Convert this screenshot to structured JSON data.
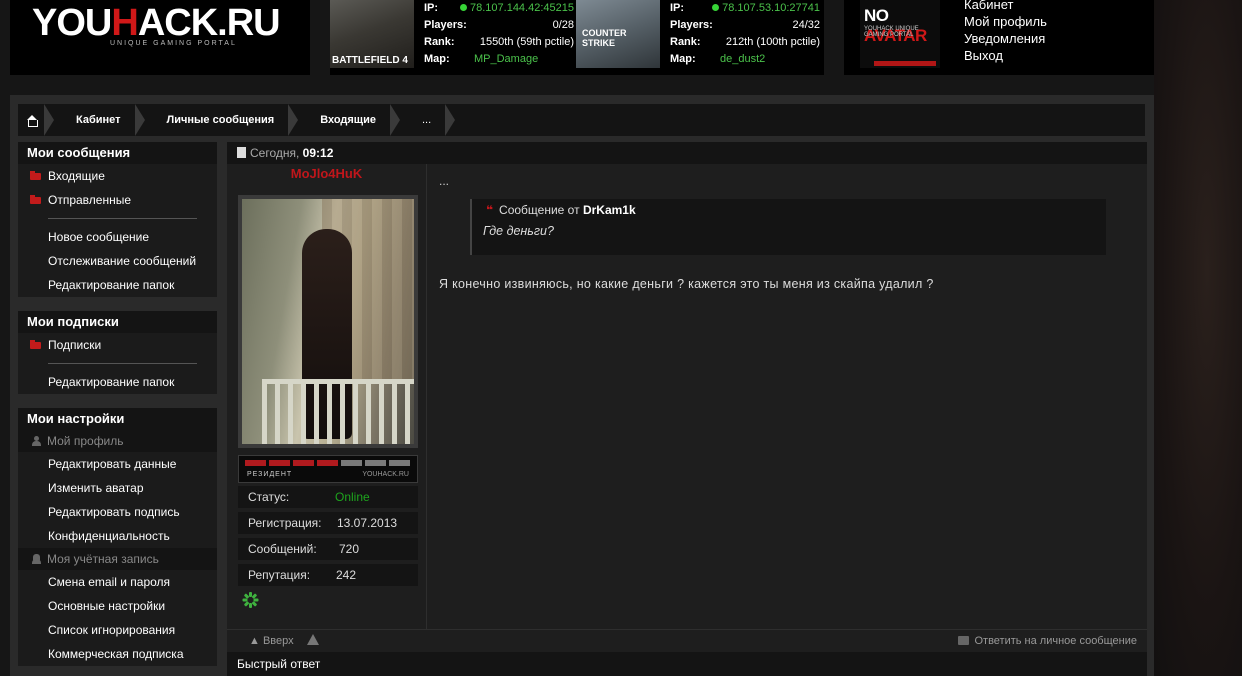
{
  "header": {
    "logo_main_left": "YOU",
    "logo_main_red": "H",
    "logo_main_right": "ACK.RU",
    "logo_sub": "UNIQUE GAMING PORTAL"
  },
  "servers": [
    {
      "game": "BATTLEFIELD 4",
      "ip_label": "IP:",
      "ip": "78.107.144.42:45215",
      "players_label": "Players:",
      "players": "0/28",
      "rank_label": "Rank:",
      "rank": "1550th (59th pctile)",
      "map_label": "Map:",
      "map": "MP_Damage"
    },
    {
      "game": "COUNTER STRIKE",
      "ip_label": "IP:",
      "ip": "78.107.53.10:27741",
      "players_label": "Players:",
      "players": "24/32",
      "rank_label": "Rank:",
      "rank": "212th (100th pctile)",
      "map_label": "Map:",
      "map": "de_dust2"
    }
  ],
  "user_menu": {
    "avatar_big_left": "NO ",
    "avatar_big_red": "AVATAR",
    "avatar_small": "YOUHACK UNIQUE GAMING PORTAL",
    "items": [
      "Кабинет",
      "Мой профиль",
      "Уведомления",
      "Выход"
    ]
  },
  "breadcrumb": [
    "Кабинет",
    "Личные сообщения",
    "Входящие",
    "..."
  ],
  "sidebar": {
    "messages": {
      "title": "Мои сообщения",
      "folders": [
        "Входящие",
        "Отправленные"
      ],
      "links": [
        "Новое сообщение",
        "Отслеживание сообщений",
        "Редактирование папок"
      ]
    },
    "subscriptions": {
      "title": "Мои подписки",
      "folders": [
        "Подписки"
      ],
      "links": [
        "Редактирование папок"
      ]
    },
    "settings": {
      "title": "Мои настройки",
      "profile_header": "Мой профиль",
      "profile_links": [
        "Редактировать данные",
        "Изменить аватар",
        "Редактировать подпись",
        "Конфиденциальность"
      ],
      "account_header": "Моя учётная запись",
      "account_links": [
        "Смена email и пароля",
        "Основные настройки",
        "Список игнорирования",
        "Коммерческая подписка"
      ]
    }
  },
  "message": {
    "date_label": "Сегодня,",
    "time": "09:12",
    "author": "MoJlo4HuK",
    "rank_title": "РЕЗИДЕНТ",
    "rank_site": "YOUHACK.RU",
    "rank_level": 4,
    "rank_max": 7,
    "stats": [
      {
        "label": "Статус:",
        "value": "Online"
      },
      {
        "label": "Регистрация:",
        "value": "13.07.2013"
      },
      {
        "label": "Сообщений:",
        "value": "720"
      },
      {
        "label": "Репутация:",
        "value": "242"
      }
    ],
    "title_line": "...",
    "quote_prefix": "Сообщение от",
    "quote_author": "DrKam1k",
    "quote_text": "Где деньги?",
    "text": "Я конечно извиняюсь, но какие деньги ? кажется это ты меня из скайпа удалил ?",
    "up_label": "Вверх",
    "reply_label": "Ответить на личное сообщение",
    "quick_reply": "Быстрый ответ"
  },
  "colors": {
    "accent_red": "#c0161b",
    "online_green": "#1ea51e",
    "server_green": "#4bc24b"
  }
}
